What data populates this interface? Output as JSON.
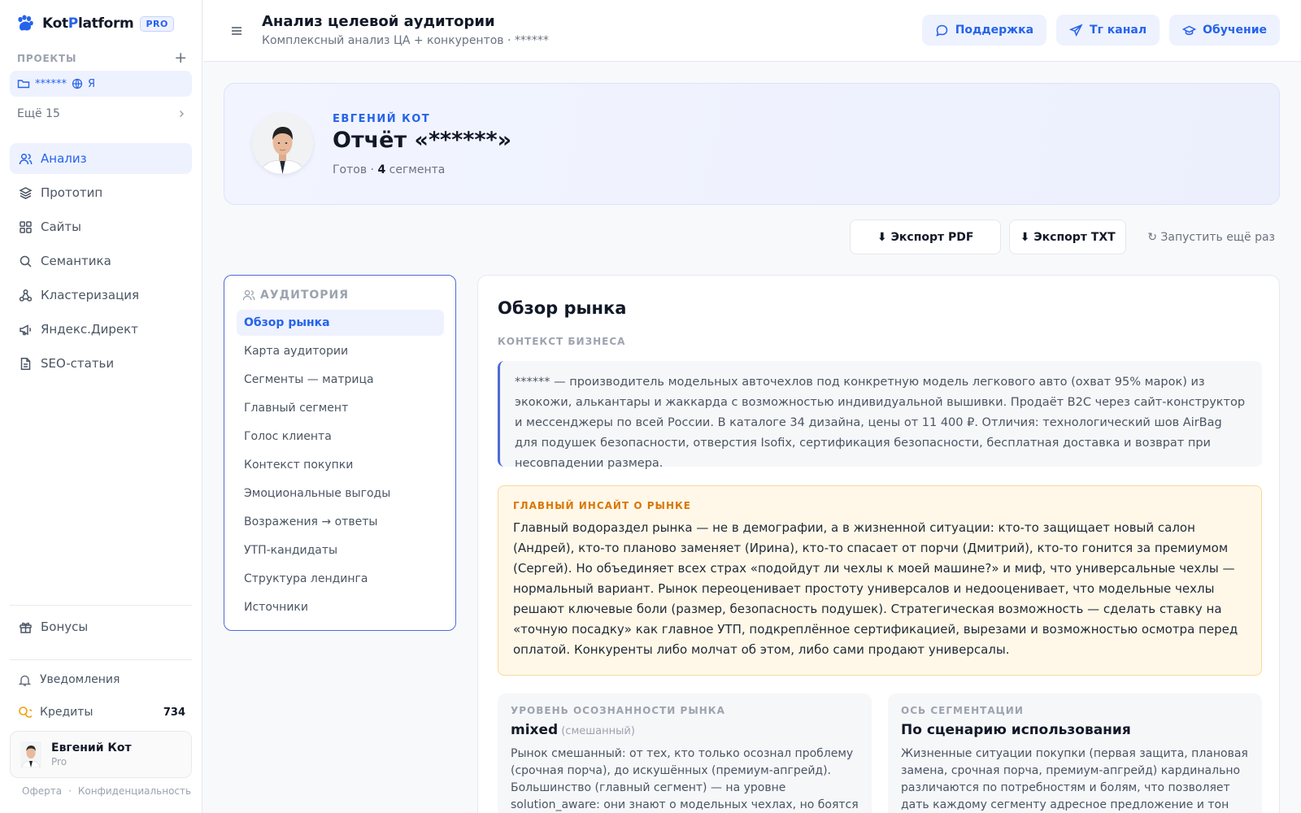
{
  "app": {
    "logo_kot": "Kot",
    "logo_p": "P",
    "logo_rest": "latform",
    "badge": "PRO"
  },
  "projects": {
    "heading": "ПРОЕКТЫ",
    "current_name": "******",
    "current_letter": "Я",
    "more_label": "Ещё 15"
  },
  "nav": [
    {
      "label": "Анализ",
      "icon": "users-icon",
      "active": true
    },
    {
      "label": "Прототип",
      "icon": "layers-icon",
      "active": false
    },
    {
      "label": "Сайты",
      "icon": "grid-icon",
      "active": false
    },
    {
      "label": "Семантика",
      "icon": "search-icon",
      "active": false
    },
    {
      "label": "Кластеризация",
      "icon": "cluster-icon",
      "active": false
    },
    {
      "label": "Яндекс.Директ",
      "icon": "megaphone-icon",
      "active": false
    },
    {
      "label": "SEO-статьи",
      "icon": "document-icon",
      "active": false
    }
  ],
  "sidebar_bottom": {
    "bonuses": "Бонусы",
    "notifications": "Уведомления",
    "credits_label": "Кредиты",
    "credits_value": "734"
  },
  "user": {
    "name": "Евгений Кот",
    "plan": "Pro"
  },
  "footer": {
    "offer": "Оферта",
    "dot": "·",
    "privacy": "Конфиденциальность"
  },
  "header": {
    "title": "Анализ целевой аудитории",
    "subtitle": "Комплексный анализ ЦА + конкурентов · ******",
    "support": "Поддержка",
    "tg": "Тг канал",
    "learning": "Обучение"
  },
  "hero": {
    "author": "ЕВГЕНИЙ КОТ",
    "title": "Отчёт «******»",
    "status": "Готов · ",
    "segments_count": "4",
    "segments_word": " сегмента"
  },
  "actions": {
    "export_pdf": "⬇ Экспорт PDF",
    "export_txt": "⬇ Экспорт TXT",
    "rerun": "↻ Запустить ещё раз"
  },
  "toc": {
    "heading": "АУДИТОРИЯ",
    "items": [
      "Обзор рынка",
      "Карта аудитории",
      "Сегменты — матрица",
      "Главный сегмент",
      "Голос клиента",
      "Контекст покупки",
      "Эмоциональные выгоды",
      "Возражения → ответы",
      "УТП-кандидаты",
      "Структура лендинга",
      "Источники"
    ],
    "active_index": 0
  },
  "main": {
    "title": "Обзор рынка",
    "context_label": "КОНТЕКСТ БИЗНЕСА",
    "context_text": "****** — производитель модельных авточехлов под конкретную модель легкового авто (охват 95% марок) из экокожи, алькантары и жаккарда с возможностью индивидуальной вышивки. Продаёт B2C через сайт-конструктор и мессенджеры по всей России. В каталоге 34 дизайна, цены от 11 400 ₽. Отличия: технологический шов AirBag для подушек безопасности, отверстия Isofix, сертификация безопасности, бесплатная доставка и возврат при несовпадении размера.",
    "insight_label": "ГЛАВНЫЙ ИНСАЙТ О РЫНКЕ",
    "insight_text": "Главный водораздел рынка — не в демографии, а в жизненной ситуации: кто-то защищает новый салон (Андрей), кто-то планово заменяет (Ирина), кто-то спасает от порчи (Дмитрий), кто-то гонится за премиумом (Сергей). Но объединяет всех страх «подойдут ли чехлы к моей машине?» и миф, что универсальные чехлы — нормальный вариант. Рынок переоценивает простоту универсалов и недооценивает, что модельные чехлы решают ключевые боли (размер, безопасность подушек). Стратегическая возможность — сделать ставку на «точную посадку» как главное УТП, подкреплённое сертификацией, вырезами и возможностью осмотра перед оплатой. Конкуренты либо молчат об этом, либо сами продают универсалы.",
    "card1": {
      "label": "УРОВЕНЬ ОСОЗНАННОСТИ РЫНКА",
      "value": "mixed",
      "value_sub": "(смешанный)",
      "text": "Рынок смешанный: от тех, кто только осознал проблему (срочная порча), до искушённых (премиум-апгрейд). Большинство (главный сегмент) — на уровне solution_aware: они знают о модельных чехлах, но боятся ошибиться."
    },
    "card2": {
      "label": "ОСЬ СЕГМЕНТАЦИИ",
      "value": "По сценарию использования",
      "text": "Жизненные ситуации покупки (первая защита, плановая замена, срочная порча, премиум-апгрейд) кардинально различаются по потребностям и болям, что позволяет дать каждому сегменту адресное предложение и тон"
    }
  },
  "colors": {
    "accent": "#2563eb",
    "accent_bg": "#eef2ff",
    "insight_bg": "#fff8e8",
    "insight_accent": "#d97706"
  }
}
